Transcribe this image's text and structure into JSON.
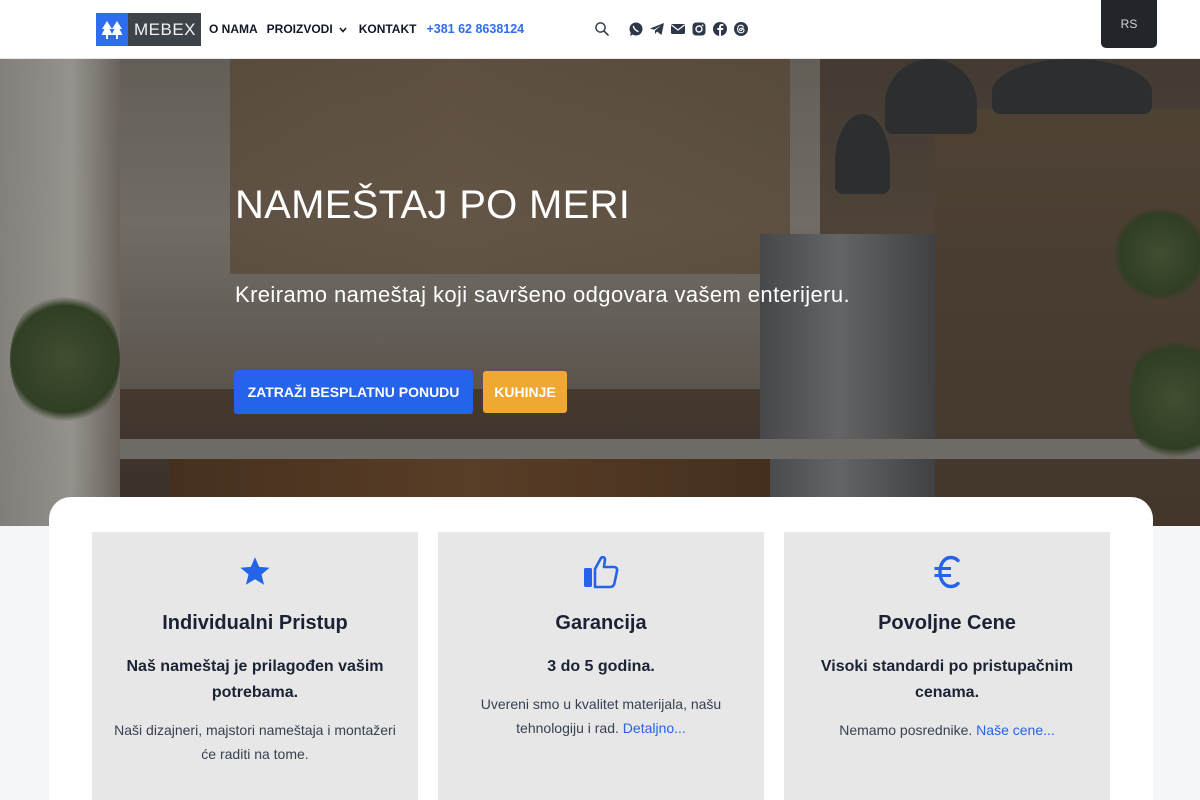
{
  "header": {
    "logo_text": "MEBEX",
    "nav": [
      "O NAMA",
      "PROIZVODI",
      "KONTAKT"
    ],
    "phone": "+381 62 8638124",
    "social_icons": [
      "whatsapp-icon",
      "telegram-icon",
      "mail-icon",
      "instagram-icon",
      "facebook-icon",
      "threads-icon"
    ],
    "language": "RS"
  },
  "hero": {
    "title": "NAMEŠTAJ PO MERI",
    "subtitle": "Kreiramo nameštaj koji savršeno odgovara vašem enterijeru.",
    "primary_button": "ZATRAŽI BESPLATNU PONUDU",
    "secondary_button": "KUHINJE"
  },
  "features": [
    {
      "icon": "star-icon",
      "title": "Individualni Pristup",
      "lead": "Naš nameštaj je prilagođen vašim potrebama.",
      "body": "Naši dizajneri, majstori nameštaja i montažeri će raditi na tome.",
      "link": ""
    },
    {
      "icon": "thumbs-up-icon",
      "title": "Garancija",
      "lead": "3 do 5 godina.",
      "body": "Uvereni smo u kvalitet materijala, našu tehnologiju i rad.",
      "link": "Detaljno..."
    },
    {
      "icon": "euro-icon",
      "title": "Povoljne Cene",
      "lead": "Visoki standardi po pristupačnim cenama.",
      "body": "Nemamo posrednike.",
      "link": "Naše cene..."
    }
  ],
  "colors": {
    "accent": "#2563eb",
    "warning": "#f0a832",
    "card_bg": "#e7e7e7",
    "logo_dark": "#3d4349"
  }
}
